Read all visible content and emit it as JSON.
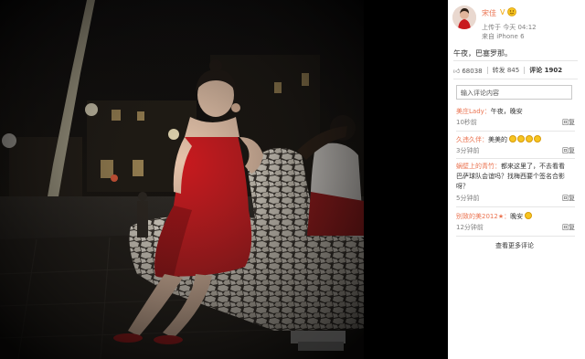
{
  "post": {
    "author_name": "宋佳",
    "verified_badge": "V",
    "time": "上传于 今天 04:12",
    "source": "来自 iPhone 6",
    "text": "午夜，巴塞罗那。"
  },
  "stats": {
    "likes": "68038",
    "reposts": "转发 845",
    "comments": "评论 1902"
  },
  "comment_input": {
    "placeholder": "输入评论内容"
  },
  "comments": [
    {
      "user": "美庄Lady：",
      "text": "午夜，晚安",
      "time": "10秒前",
      "reply": "回复",
      "emoji_count": 0
    },
    {
      "user": "久违久伴：",
      "text": "美美的",
      "time": "3分钟前",
      "reply": "回复",
      "emoji_count": 4
    },
    {
      "user": "蜗壁上的青竹：",
      "text": "都来这里了，不去看看",
      "text2": "巴萨球队会谊吗？找梅西要个签名合影",
      "text3": "呀？",
      "time": "5分钟前",
      "reply": "回复",
      "emoji_count": 0
    },
    {
      "user": "别致的美2012",
      "user_suffix": "★：",
      "text": "晚安",
      "time": "12分钟前",
      "reply": "回复",
      "emoji_count": 1
    }
  ],
  "more_comments": "查看更多评论",
  "colors": {
    "name_orange": "#eb7350",
    "dress_red": "#c8191e",
    "bench_white": "#e8e4dc",
    "emoji_yellow": "#f7c520"
  },
  "icons": [
    "like-icon",
    "smiley-icon",
    "verified-icon"
  ]
}
